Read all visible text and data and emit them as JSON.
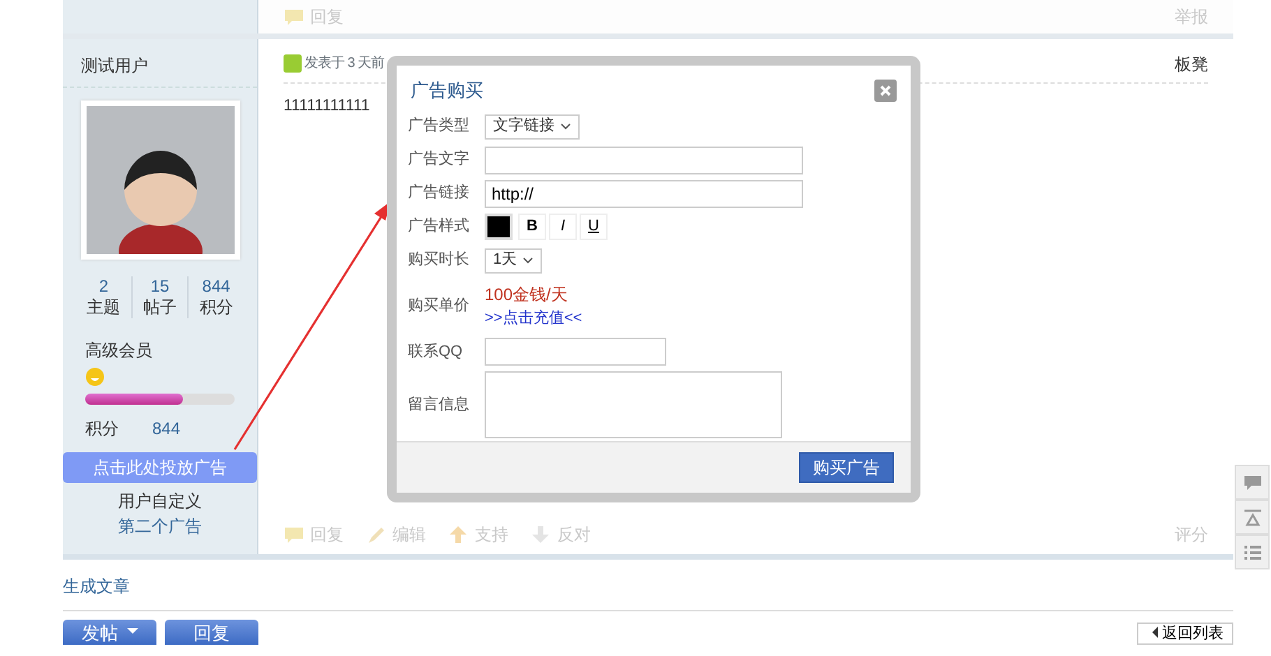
{
  "previous_post": {
    "actions": [
      {
        "kind": "comment",
        "label": "回复"
      }
    ],
    "report": "举报"
  },
  "author": {
    "name": "测试用户",
    "stats": [
      {
        "value": "2",
        "label": "主题"
      },
      {
        "value": "15",
        "label": "帖子"
      },
      {
        "value": "844",
        "label": "积分"
      }
    ],
    "group": "高级会员",
    "level": 0.65,
    "points_label": "积分",
    "points": "844",
    "ad_button": "点击此处投放广告",
    "custom_label": "用户自定义",
    "custom_link": "第二个广告"
  },
  "post": {
    "meta": "发表于 3 天前",
    "floor": "板凳",
    "content": "11111111111",
    "actions": [
      {
        "kind": "comment",
        "label": "回复"
      },
      {
        "kind": "pencil",
        "label": "编辑"
      },
      {
        "kind": "up",
        "label": "支持"
      },
      {
        "kind": "down",
        "label": "反对"
      }
    ],
    "rate": "评分"
  },
  "dialog": {
    "title": "广告购买",
    "fields": [
      {
        "kind": "select",
        "label": "广告类型",
        "value": "文字链接"
      },
      {
        "kind": "input",
        "label": "广告文字"
      },
      {
        "kind": "input",
        "label": "广告链接",
        "value": "http://"
      },
      {
        "kind": "style",
        "label": "广告样式",
        "buttons": [
          "B",
          "I",
          "U"
        ]
      },
      {
        "kind": "select",
        "label": "购买时长",
        "value": "1天"
      },
      {
        "kind": "price",
        "label": "购买单价",
        "price": "100金钱/天",
        "link": ">>点击充值<<"
      },
      {
        "kind": "short-input",
        "label": "联系QQ"
      },
      {
        "kind": "textarea",
        "label": "留言信息"
      }
    ],
    "submit": "购买广告"
  },
  "footer_link": "生成文章",
  "buttons": [
    {
      "label": "发帖",
      "caret": true
    },
    {
      "label": "回复",
      "caret": false
    }
  ],
  "back": "返回列表"
}
